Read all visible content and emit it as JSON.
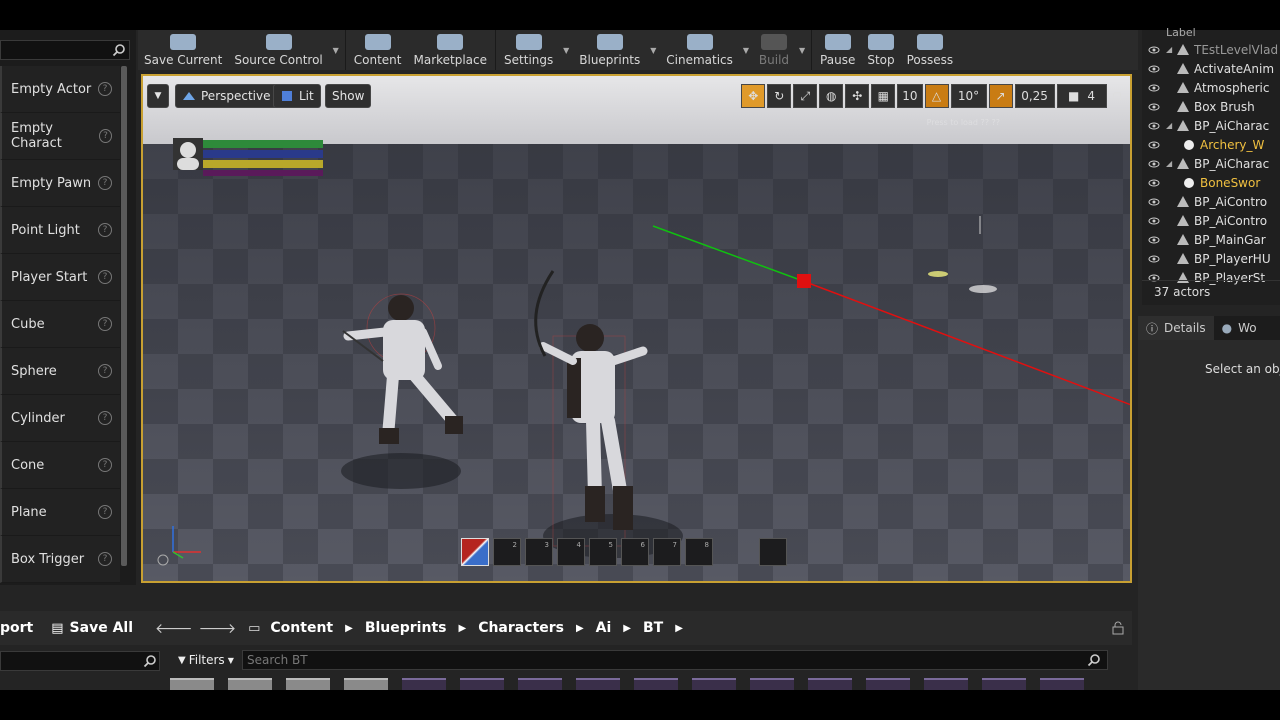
{
  "toolbar": {
    "items": [
      {
        "label": "Save Current",
        "icon": "save-icon",
        "has_arrow": false
      },
      {
        "label": "Source Control",
        "icon": "source-control-icon",
        "has_arrow": true
      },
      {
        "label": "Content",
        "icon": "content-icon",
        "has_arrow": false
      },
      {
        "label": "Marketplace",
        "icon": "marketplace-icon",
        "has_arrow": false
      },
      {
        "label": "Settings",
        "icon": "settings-icon",
        "has_arrow": true
      },
      {
        "label": "Blueprints",
        "icon": "blueprints-icon",
        "has_arrow": true
      },
      {
        "label": "Cinematics",
        "icon": "cinematics-icon",
        "has_arrow": true
      },
      {
        "label": "Build",
        "icon": "build-icon",
        "has_arrow": true,
        "disabled": true
      },
      {
        "label": "Pause",
        "icon": "pause-icon",
        "has_arrow": false
      },
      {
        "label": "Stop",
        "icon": "stop-icon",
        "has_arrow": false
      },
      {
        "label": "Possess",
        "icon": "possess-icon",
        "has_arrow": false
      }
    ]
  },
  "place_actors": {
    "items": [
      "Empty Actor",
      "Empty Charact",
      "Empty Pawn",
      "Point Light",
      "Player Start",
      "Cube",
      "Sphere",
      "Cylinder",
      "Cone",
      "Plane",
      "Box Trigger"
    ],
    "help_glyph": "?"
  },
  "viewport": {
    "view_mode": "Perspective",
    "lighting": "Lit",
    "show": "Show",
    "grid_snap": "10",
    "rotation_snap": "10°",
    "scale_snap": "0,25",
    "camera_speed": "4",
    "hotbar_slots": [
      "",
      "2",
      "3",
      "4",
      "5",
      "6",
      "7",
      "8"
    ]
  },
  "outliner": {
    "header": "Label",
    "rows": [
      {
        "name": "TEstLevelVlad",
        "child": false,
        "exp": "◢",
        "dim": true
      },
      {
        "name": "ActivateAnim",
        "child": false,
        "exp": ""
      },
      {
        "name": "Atmospheric",
        "child": false,
        "exp": ""
      },
      {
        "name": "Box Brush",
        "child": false,
        "exp": ""
      },
      {
        "name": "BP_AiCharac",
        "child": false,
        "exp": "◢"
      },
      {
        "name": "Archery_W",
        "child": true,
        "exp": ""
      },
      {
        "name": "BP_AiCharac",
        "child": false,
        "exp": "◢"
      },
      {
        "name": "BoneSwor",
        "child": true,
        "exp": ""
      },
      {
        "name": "BP_AiContro",
        "child": false,
        "exp": ""
      },
      {
        "name": "BP_AiContro",
        "child": false,
        "exp": ""
      },
      {
        "name": "BP_MainGar",
        "child": false,
        "exp": ""
      },
      {
        "name": "BP_PlayerHU",
        "child": false,
        "exp": ""
      },
      {
        "name": "BP_PlayerSt",
        "child": false,
        "exp": ""
      }
    ],
    "count": "37 actors"
  },
  "details": {
    "tab_details": "Details",
    "tab_world": "Wo",
    "message": "Select an obje"
  },
  "content_browser": {
    "import_label": "port",
    "save_all": "Save All",
    "path": [
      "Content",
      "Blueprints",
      "Characters",
      "Ai",
      "BT"
    ],
    "filters": "Filters",
    "search_placeholder": "Search BT"
  },
  "colors": {
    "accent_border": "#c8a032",
    "hud_green": "#2e8a3a",
    "hud_blue": "#2a3a8a",
    "hud_yellow": "#b8a82a",
    "hud_purple": "#5a1a5a",
    "gizmo_red": "#e01010",
    "gizmo_green": "#10c010"
  }
}
